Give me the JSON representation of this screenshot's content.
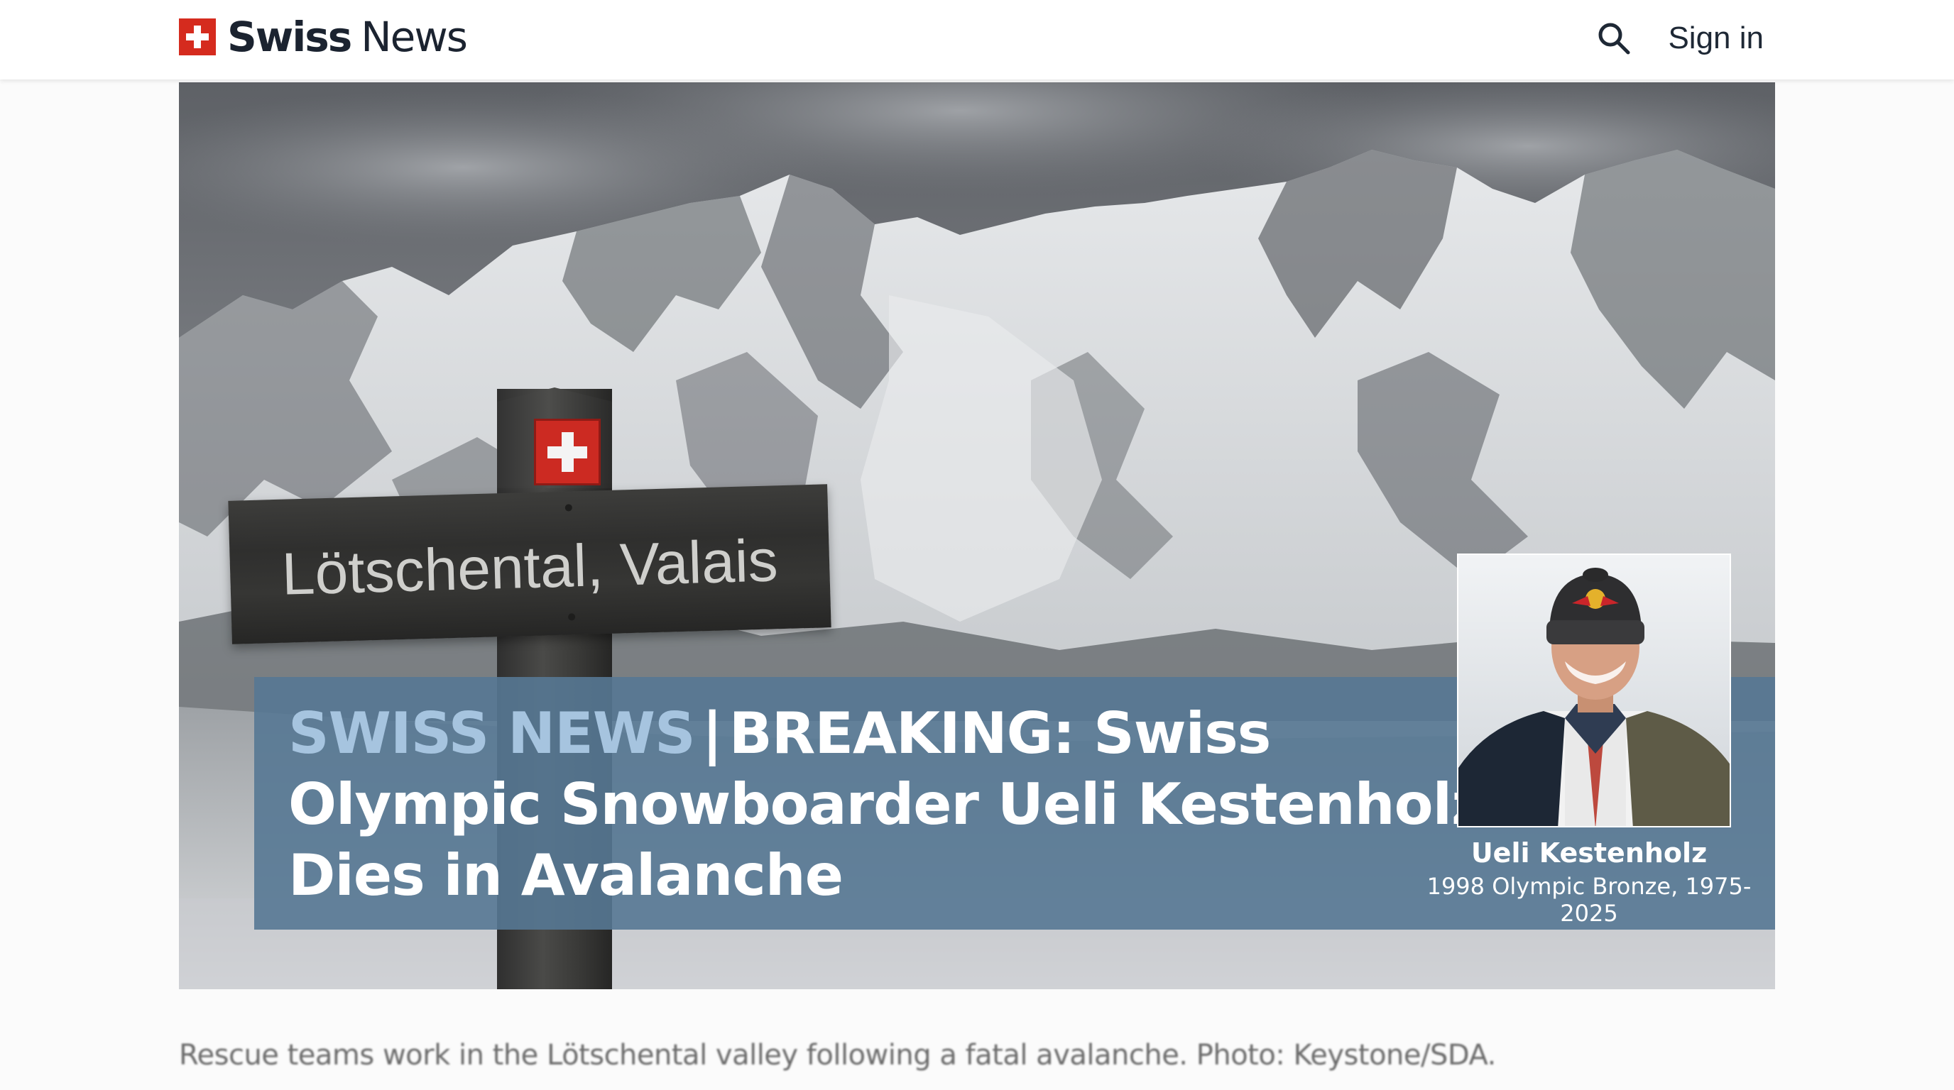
{
  "header": {
    "brand_bold": "Swiss",
    "brand_regular": "News",
    "search_icon": "search-icon",
    "signin_label": "Sign in"
  },
  "hero": {
    "sign_text": "Lötschental, Valais",
    "headline_kicker": "SWISS NEWS",
    "headline_separator": "|",
    "headline_text": "BREAKING: Swiss Olympic Snowboarder Ueli Kestenholz Dies in Avalanche",
    "portrait": {
      "name": "Ueli Kestenholz",
      "caption": "1998 Olympic Bronze, 1975-2025",
      "beanie_logo": "Red Bull"
    }
  },
  "photo_caption": "Rescue teams work in the Lötschental valley following a fatal avalanche. Photo: Keystone/SDA.",
  "colors": {
    "brand_red": "#d52b1e",
    "banner_blue": "#56789a",
    "kicker_blue": "#a6c4df",
    "header_text": "#1b2330"
  }
}
